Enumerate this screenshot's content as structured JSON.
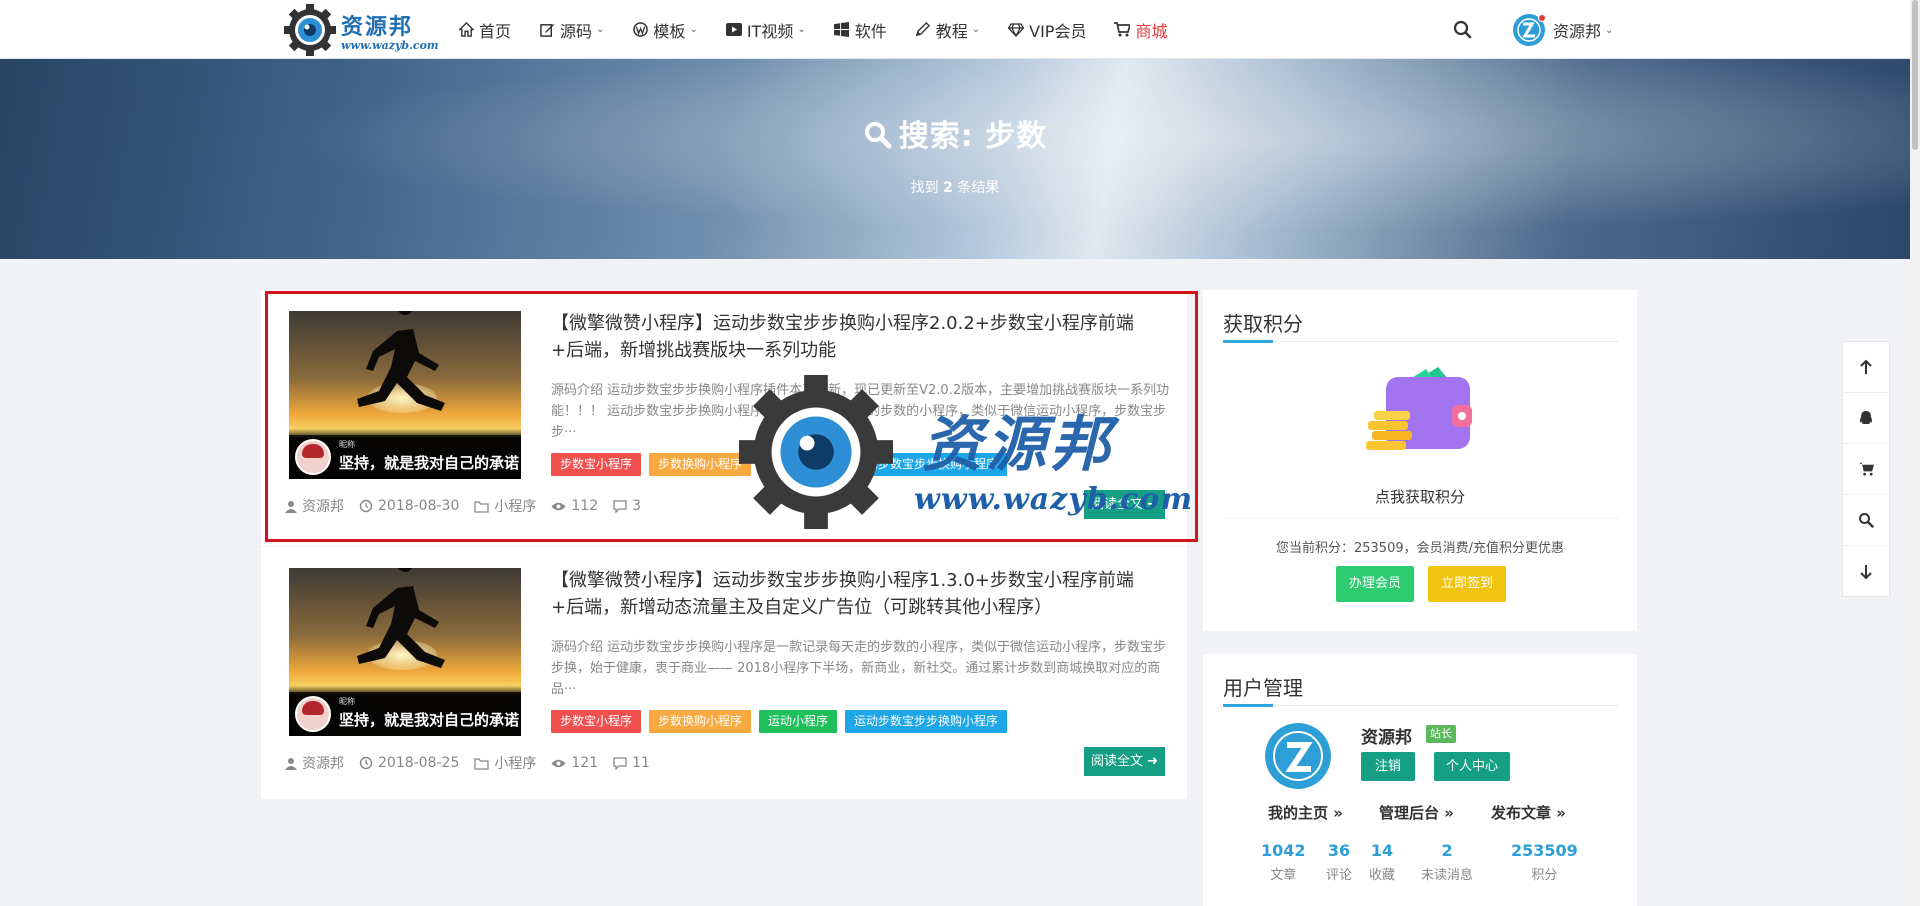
{
  "header": {
    "logo": {
      "brand": "资源邦",
      "url": "www.wazyb.com"
    },
    "nav": [
      {
        "label": "首页",
        "icon": "home-icon",
        "caret": false
      },
      {
        "label": "源码",
        "icon": "edit-icon",
        "caret": true
      },
      {
        "label": "模板",
        "icon": "wordpress-icon",
        "caret": true
      },
      {
        "label": "IT视频",
        "icon": "video-icon",
        "caret": true
      },
      {
        "label": "软件",
        "icon": "windows-icon",
        "caret": false
      },
      {
        "label": "教程",
        "icon": "pencil-icon",
        "caret": true
      },
      {
        "label": "VIP会员",
        "icon": "diamond-icon",
        "caret": false
      },
      {
        "label": "商城",
        "icon": "cart-icon",
        "caret": false
      }
    ],
    "user_label": "资源邦"
  },
  "banner": {
    "title": "搜索: 步数",
    "sub_prefix": "找到 ",
    "count": "2",
    "sub_suffix": " 条结果"
  },
  "posts": [
    {
      "title": "【微擎微赞小程序】运动步数宝步步换购小程序2.0.2+步数宝小程序前端+后端，新增挑战赛版块一系列功能",
      "excerpt": "源码介绍 运动步数宝步步换购小程序插件本次更新，现已更新至V2.0.2版本，主要增加挑战赛版块一系列功能！！！ 运动步数宝步步换购小程序是一款记录每天走的步数的小程序，类似于微信运动小程序，步数宝步步···",
      "thumb_small": "昵称",
      "thumb_quote": "坚持，就是我对自己的承诺",
      "tags": [
        "步数宝小程序",
        "步数换购小程序",
        "运动小程序",
        "运动步数宝步步换购小程序"
      ],
      "author": "资源邦",
      "date": "2018-08-30",
      "category": "小程序",
      "views": "112",
      "comments": "3",
      "read": "阅读全文"
    },
    {
      "title": "【微擎微赞小程序】运动步数宝步步换购小程序1.3.0+步数宝小程序前端+后端，新增动态流量主及自定义广告位（可跳转其他小程序）",
      "excerpt": "源码介绍 运动步数宝步步换购小程序是一款记录每天走的步数的小程序，类似于微信运动小程序，步数宝步步换，始于健康，衷于商业—— 2018小程序下半场，新商业，新社交。通过累计步数到商城换取对应的商品···",
      "thumb_small": "昵称",
      "thumb_quote": "坚持，就是我对自己的承诺",
      "tags": [
        "步数宝小程序",
        "步数换购小程序",
        "运动小程序",
        "运动步数宝步步换购小程序"
      ],
      "author": "资源邦",
      "date": "2018-08-25",
      "category": "小程序",
      "views": "121",
      "comments": "11",
      "read": "阅读全文"
    }
  ],
  "tag_colors": [
    "#f0504e",
    "#f7a940",
    "#1fbf5c",
    "#1da7e8"
  ],
  "points_card": {
    "title": "获取积分",
    "link": "点我获取积分",
    "info": "您当前积分：253509，会员消费/充值积分更优惠",
    "vip_button": "办理会员",
    "sign_button": "立即签到"
  },
  "user_card": {
    "title": "用户管理",
    "name": "资源邦",
    "role": "站长",
    "logout": "注销",
    "center": "个人中心",
    "links": [
      "我的主页 »",
      "管理后台 »",
      "发布文章 »"
    ],
    "stats": [
      {
        "n": "1042",
        "t": "文章"
      },
      {
        "n": "36",
        "t": "评论"
      },
      {
        "n": "14",
        "t": "收藏"
      },
      {
        "n": "2",
        "t": "未读消息"
      },
      {
        "n": "253509",
        "t": "积分"
      }
    ]
  },
  "watermark": {
    "brand": "资源邦",
    "url": "www.wazyb.com"
  },
  "colors": {
    "accent": "#15a085",
    "brand_blue": "#1f6fb2",
    "shop_red": "#e4393c",
    "highlight": "#d0141a"
  }
}
